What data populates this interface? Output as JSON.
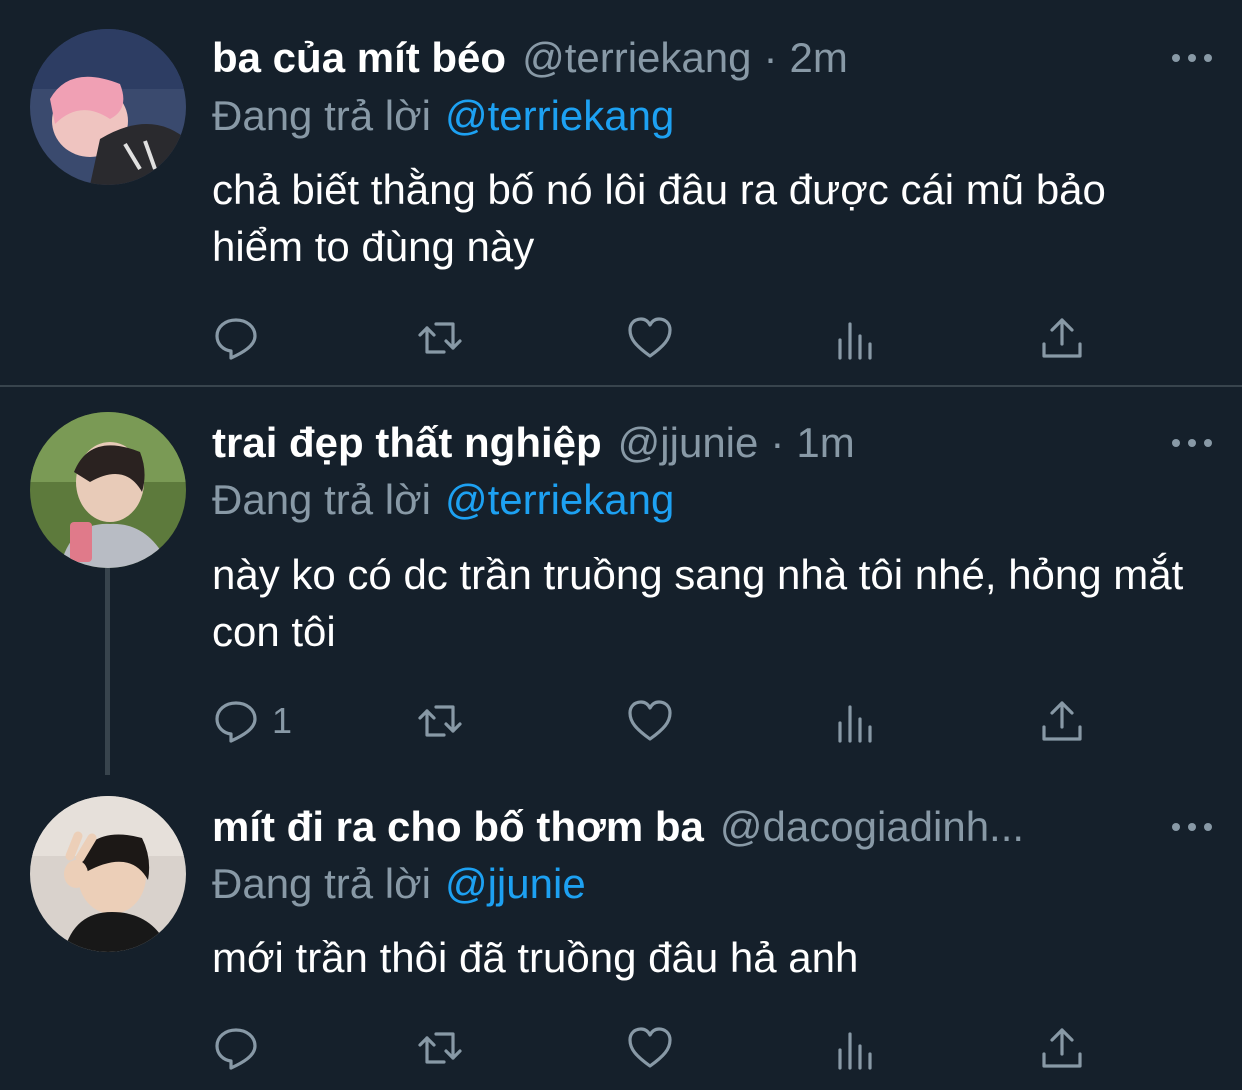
{
  "tweets": [
    {
      "name": "ba của mít béo",
      "handle": "@terriekang",
      "time": "2m",
      "replying_label": "Đang trả lời",
      "replying_to": "@terriekang",
      "text": "chả biết thằng bố nó lôi đâu ra được cái mũ bảo hiểm to đùng này",
      "reply_count": "",
      "avatar_icon": "avatar-photo-pink-hair"
    },
    {
      "name": "trai đẹp thất nghiệp",
      "handle": "@jjunie",
      "time": "1m",
      "replying_label": "Đang trả lời",
      "replying_to": "@terriekang",
      "text": "này ko có dc trần truồng sang nhà tôi nhé, hỏng mắt con tôi",
      "reply_count": "1",
      "avatar_icon": "avatar-photo-outdoor"
    },
    {
      "name": "mít đi ra cho bố thơm ba",
      "handle": "@dacogiadinh...",
      "time": "",
      "replying_label": "Đang trả lời",
      "replying_to": "@jjunie",
      "text": "mới trần thôi đã truồng đâu hả anh",
      "reply_count": "",
      "avatar_icon": "avatar-photo-peace-sign"
    }
  ],
  "action_icons": [
    "reply-icon",
    "retweet-icon",
    "like-icon",
    "analytics-icon",
    "share-icon"
  ],
  "colors": {
    "background": "#15202b",
    "secondary_text": "#8899a6",
    "mention": "#1da1f2",
    "divider": "#38444d"
  }
}
